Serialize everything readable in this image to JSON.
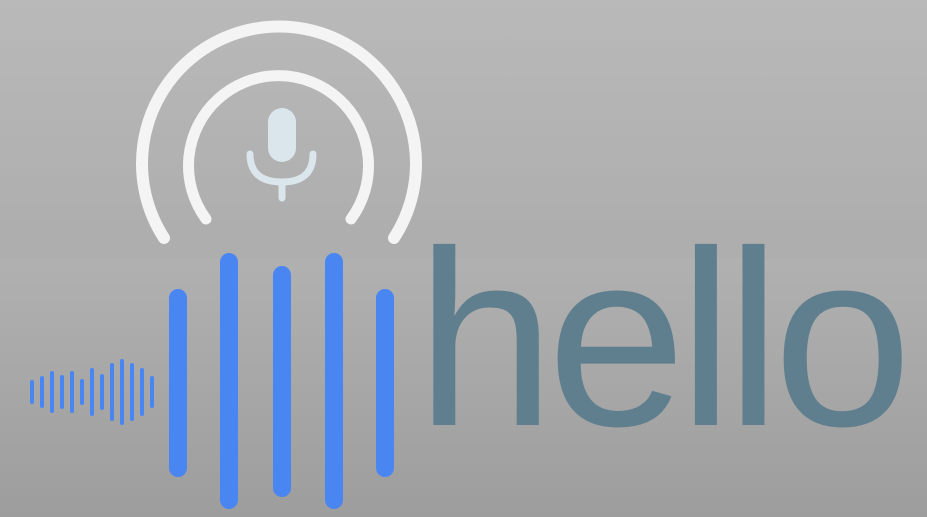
{
  "logo": {
    "wordmark": "hello",
    "icon_names": [
      "signal-arc-icon",
      "microphone-icon",
      "sound-wave-icon"
    ],
    "colors": {
      "background": "#b3b3b3",
      "wave": "#4a86f2",
      "wordmark": "#5f7f8f",
      "arc": "#f5f5f5",
      "microphone": "#dfe8ee"
    }
  }
}
